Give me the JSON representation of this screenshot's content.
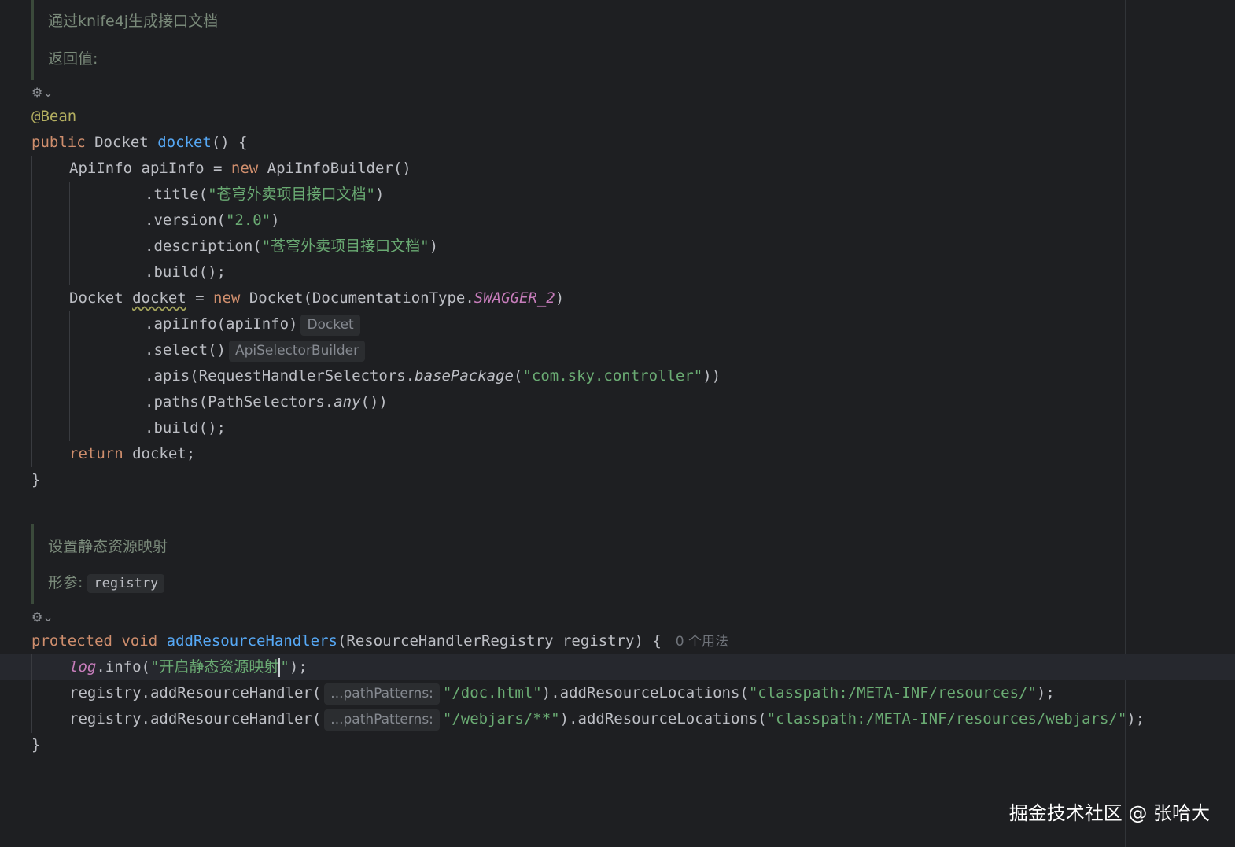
{
  "editor": {
    "docs": {
      "doc1": {
        "summary": "通过knife4j生成接口文档",
        "returns_label": "返回值:"
      },
      "doc2": {
        "summary": "设置静态资源映射",
        "param_label": "形参:",
        "param_name": "registry"
      }
    },
    "code": {
      "annotation": "@Bean",
      "kw_public": "public",
      "type_docket": "Docket",
      "method_docket": "docket",
      "paren_open_brace": "() {",
      "apiinfo_decl": "ApiInfo apiInfo = ",
      "kw_new": "new",
      "apiinfobuilder": " ApiInfoBuilder()",
      "title_call": ".title(",
      "title_str": "\"苍穹外卖项目接口文档\"",
      "close_paren": ")",
      "version_call": ".version(",
      "version_str": "\"2.0\"",
      "description_call": ".description(",
      "description_str": "\"苍穹外卖项目接口文档\"",
      "build_call": ".build();",
      "docket_decl_type": "Docket ",
      "docket_var": "docket",
      "assign": " = ",
      "docket_ctor": " Docket(DocumentationType.",
      "swagger_const": "SWAGGER_2",
      "apiinfo_call": ".apiInfo(apiInfo)",
      "hint_docket": "Docket",
      "select_call": ".select()",
      "hint_apiselector": "ApiSelectorBuilder",
      "apis_call_start": ".apis(RequestHandlerSelectors.",
      "basepackage": "basePackage",
      "paren_open": "(",
      "package_str": "\"com.sky.controller\"",
      "double_close": "))",
      "paths_call_start": ".paths(PathSelectors.",
      "any_call": "any",
      "any_close": "())",
      "kw_return": "return",
      "return_rest": " docket;",
      "close_brace": "}",
      "kw_protected": "protected",
      "kw_void": "void",
      "method_addresource": "addResourceHandlers",
      "addresource_params": "(ResourceHandlerRegistry registry) {",
      "usage_count": "0 个用法",
      "log_field": "log",
      "info_call": ".info(",
      "log_str_before_caret": "\"开启静态资源映射",
      "log_str_after_caret": "\"",
      "log_close": ");",
      "registry_call": "registry.addResourceHandler(",
      "hint_pathpatterns": "...pathPatterns:",
      "doc_html_str": "\"/doc.html\"",
      "addlocations_call": ").addResourceLocations(",
      "resources_str": "\"classpath:/META-INF/resources/\"",
      "webjars_str": "\"/webjars/**\"",
      "resources_webjars_str": "\"classpath:/META-INF/resources/webjars/\"",
      "stmt_end": ");"
    },
    "gutter": {
      "icon1": "⚙⌄",
      "icon2": "⚙⌄"
    }
  },
  "watermark": "掘金技术社区 @ 张哈大",
  "colors": {
    "background": "#1e1f22",
    "keyword": "#cf8e6d",
    "string": "#6aab73",
    "function": "#56a8f5",
    "annotation": "#b3ae60",
    "constant": "#c77dbb"
  }
}
